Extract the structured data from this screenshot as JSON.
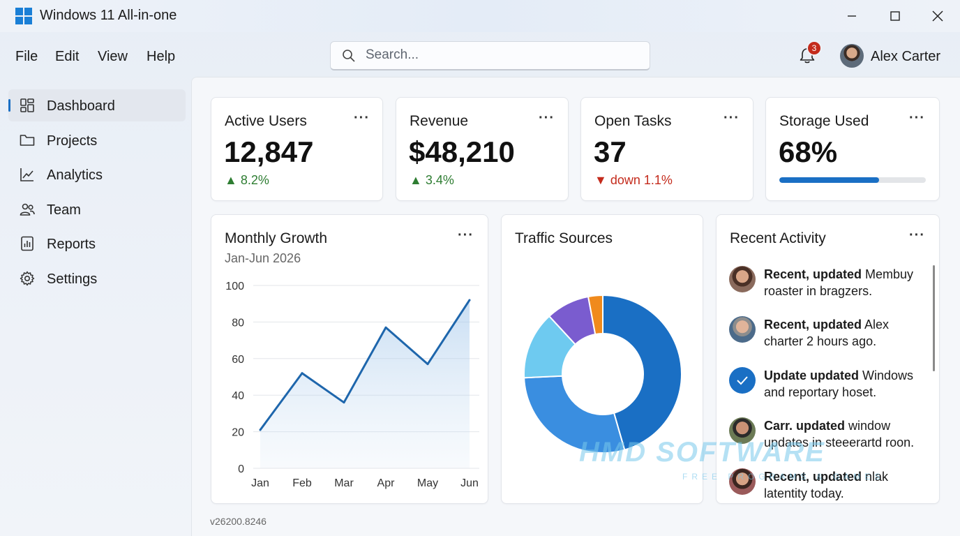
{
  "window": {
    "title": "Windows 11 All-in-one",
    "minimize_icon": "minimize-icon",
    "maximize_icon": "maximize-icon",
    "close_icon": "close-icon"
  },
  "menu": [
    "File",
    "Edit",
    "View",
    "Help"
  ],
  "search": {
    "placeholder": "Search..."
  },
  "notifications": {
    "count": "3"
  },
  "user": {
    "name": "Alex Carter"
  },
  "sidebar": {
    "items": [
      {
        "label": "Dashboard",
        "icon": "dashboard-icon",
        "active": true
      },
      {
        "label": "Projects",
        "icon": "folder-icon",
        "active": false
      },
      {
        "label": "Analytics",
        "icon": "line-chart-icon",
        "active": false
      },
      {
        "label": "Team",
        "icon": "people-icon",
        "active": false
      },
      {
        "label": "Reports",
        "icon": "report-icon",
        "active": false
      },
      {
        "label": "Settings",
        "icon": "gear-icon",
        "active": false
      }
    ]
  },
  "kpis": [
    {
      "title": "Active Users",
      "value": "12,847",
      "delta": "8.2%",
      "trend": "up"
    },
    {
      "title": "Revenue",
      "value": "$48,210",
      "delta": "3.4%",
      "trend": "up"
    },
    {
      "title": "Open Tasks",
      "value": "37",
      "delta": "down 1.1%",
      "trend": "down"
    },
    {
      "title": "Storage Used",
      "value": "68%",
      "progress": 0.68
    }
  ],
  "growth": {
    "title": "Monthly Growth",
    "subtitle": "Jan-Jun 2026"
  },
  "traffic": {
    "title": "Traffic Sources"
  },
  "activity": {
    "title": "Recent Activity",
    "items": [
      {
        "bold": "Recent, updated",
        "text": " Membuy roaster in bragzers."
      },
      {
        "bold": "Recent, updated",
        "text": " Alex charter 2 hours ago."
      },
      {
        "bold": "Update updated",
        "text": " Windows and reportary hoset."
      },
      {
        "bold": "Carr. updated",
        "text": " window updates in steeerartd roon."
      },
      {
        "bold": "Recent, updated",
        "text": " nlak latentity today."
      }
    ]
  },
  "version": "v26200.8246",
  "watermark": {
    "main": "HMD SOFTWARE",
    "sub": "FREE PROGRAMS & GAMES"
  },
  "colors": {
    "accent": "#1a6fc4",
    "up": "#2e7d32",
    "down": "#c42b1c"
  },
  "chart_data": [
    {
      "type": "area",
      "title": "Monthly Growth",
      "subtitle": "Jan-Jun 2026",
      "categories": [
        "Jan",
        "Feb",
        "Mar",
        "Apr",
        "May",
        "Jun"
      ],
      "values": [
        21,
        52,
        36,
        77,
        57,
        92
      ],
      "ylim": [
        0,
        100
      ],
      "yticks": [
        0,
        20,
        40,
        60,
        80,
        100
      ],
      "grid": true
    },
    {
      "type": "pie",
      "title": "Traffic Sources",
      "donut": true,
      "values": [
        46,
        29,
        14,
        9,
        3
      ],
      "colors": [
        "#1a6fc4",
        "#3a8ee0",
        "#6ecaf0",
        "#7a5ccf",
        "#f08a1d"
      ]
    }
  ]
}
